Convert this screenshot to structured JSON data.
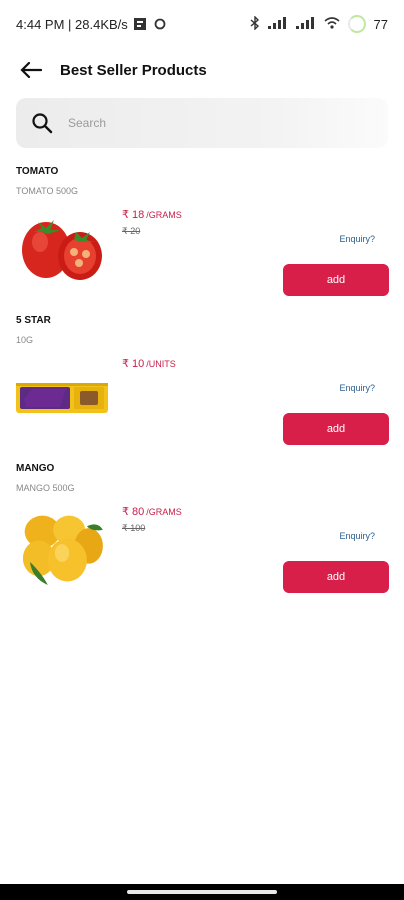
{
  "status_bar": {
    "time_speed": "4:44 PM | 28.4KB/s",
    "battery": "77"
  },
  "header": {
    "title": "Best Seller Products"
  },
  "search": {
    "placeholder": "Search"
  },
  "products": [
    {
      "name": "TOMATO",
      "subtitle": "TOMATO 500G",
      "price": "₹ 18",
      "unit": "/GRAMS",
      "mrp": "₹ 20",
      "enquiry": "Enquiry?",
      "add_label": "add",
      "image_icon": "tomato"
    },
    {
      "name": "5 STAR",
      "subtitle": "10G",
      "price": "₹ 10",
      "unit": "/UNITS",
      "mrp": "",
      "enquiry": "Enquiry?",
      "add_label": "add",
      "image_icon": "chocolate-bar"
    },
    {
      "name": "MANGO",
      "subtitle": "MANGO 500G",
      "price": "₹ 80",
      "unit": "/GRAMS",
      "mrp": "₹ 100",
      "enquiry": "Enquiry?",
      "add_label": "add",
      "image_icon": "mango"
    }
  ],
  "colors": {
    "accent": "#d81f4a",
    "price": "#c81e4a",
    "link": "#2a5d8c"
  }
}
